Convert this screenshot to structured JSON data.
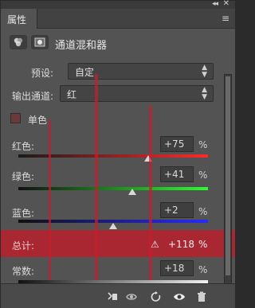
{
  "panel": {
    "tab_label": "属性",
    "collapse_icon": "◂◂",
    "close_icon": "✕",
    "menu_icon": "≡"
  },
  "header": {
    "title": "通道混和器"
  },
  "preset": {
    "label": "预设:",
    "value": "自定"
  },
  "output_channel": {
    "label": "输出通道:",
    "value": "红"
  },
  "monochrome": {
    "label": "单色"
  },
  "sliders": [
    {
      "name": "red",
      "label": "红色:",
      "value": "+75",
      "unit": "%"
    },
    {
      "name": "green",
      "label": "绿色:",
      "value": "+41",
      "unit": "%"
    },
    {
      "name": "blue",
      "label": "蓝色:",
      "value": "+2",
      "unit": "%"
    }
  ],
  "total": {
    "label": "总计:",
    "warning_icon": "⚠",
    "value": "+118",
    "unit": "%"
  },
  "constant": {
    "label": "常数:",
    "value": "+18",
    "unit": "%"
  },
  "bottom_icons": [
    "clip-to-layer-icon",
    "eye-toggle-icon",
    "reset-icon",
    "visibility-icon",
    "trash-icon"
  ],
  "colors": {
    "accent_red": "#b8202c",
    "panel_bg": "#535353"
  }
}
